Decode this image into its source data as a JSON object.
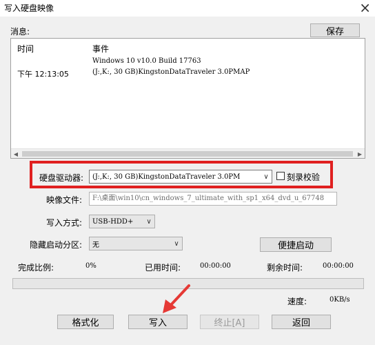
{
  "window": {
    "title": "写入硬盘映像",
    "close_symbol": "×"
  },
  "messages": {
    "label": "消息:",
    "save_label": "保存",
    "col_time": "时间",
    "col_event": "事件",
    "rows": [
      {
        "time": "",
        "event": "Windows 10 v10.0 Build 17763"
      },
      {
        "time": "下午 12:13:05",
        "event": "(J:,K:, 30 GB)KingstonDataTraveler 3.0PMAP"
      }
    ]
  },
  "drive": {
    "label": "硬盘驱动器:",
    "value": "(J:,K:, 30 GB)KingstonDataTraveler 3.0PM",
    "verify_label": "刻录校验",
    "verify_checked": false
  },
  "image_file": {
    "label": "映像文件:",
    "value": "F:\\桌面\\win10\\cn_windows_7_ultimate_with_sp1_x64_dvd_u_67748"
  },
  "write_mode": {
    "label": "写入方式:",
    "value": "USB-HDD+"
  },
  "hidden_partition": {
    "label": "隐藏启动分区:",
    "value": "无",
    "quick_boot_label": "便捷启动"
  },
  "status": {
    "complete_label": "完成比例:",
    "complete_value": "0%",
    "elapsed_label": "已用时间:",
    "elapsed_value": "00:00:00",
    "remaining_label": "剩余时间:",
    "remaining_value": "00:00:00",
    "progress": 0,
    "speed_label": "速度:",
    "speed_value": "0KB/s"
  },
  "buttons": {
    "format": "格式化",
    "write": "写入",
    "stop": "终止[A]",
    "back": "返回"
  },
  "colors": {
    "highlight_frame": "#e02020",
    "arrow": "#e53935"
  }
}
